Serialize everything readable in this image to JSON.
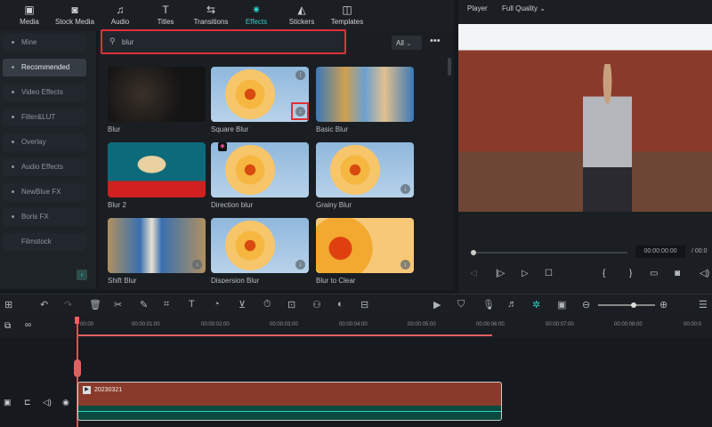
{
  "nav": [
    {
      "label": "Media",
      "icon": "media-icon"
    },
    {
      "label": "Stock Media",
      "icon": "stock-media-icon"
    },
    {
      "label": "Audio",
      "icon": "music-note-icon"
    },
    {
      "label": "Titles",
      "icon": "text-icon"
    },
    {
      "label": "Transitions",
      "icon": "transition-icon"
    },
    {
      "label": "Effects",
      "icon": "sparkle-icon"
    },
    {
      "label": "Stickers",
      "icon": "sticker-icon"
    },
    {
      "label": "Templates",
      "icon": "template-icon"
    }
  ],
  "sidebar": [
    "Mine",
    "Recommended",
    "Video Effects",
    "Filter&LUT",
    "Overlay",
    "Audio Effects",
    "NewBlue FX",
    "Boris FX",
    "Filmstock"
  ],
  "search": {
    "value": "blur",
    "filter": "All"
  },
  "effects": [
    "Blur",
    "Square Blur",
    "Basic Blur",
    "Blur 2",
    "Direction blur",
    "Grainy Blur",
    "Shift Blur",
    "Dispersion Blur",
    "Blur to Clear"
  ],
  "player": {
    "title": "Player",
    "quality": "Full Quality",
    "time": "00:00:00:00",
    "separator": "/ 00:0"
  },
  "ruler": [
    "00:00",
    "00:00:01:00",
    "00:00:02:00",
    "00:00:03:00",
    "00:00:04:00",
    "00:00:05:00",
    "00:00:06:00",
    "00:00:07:00",
    "00:00:08:00",
    "00:00:0"
  ],
  "clip": {
    "name": "20230321"
  },
  "colors": {
    "accent": "#2ed1c6",
    "highlight": "#e0303a"
  }
}
